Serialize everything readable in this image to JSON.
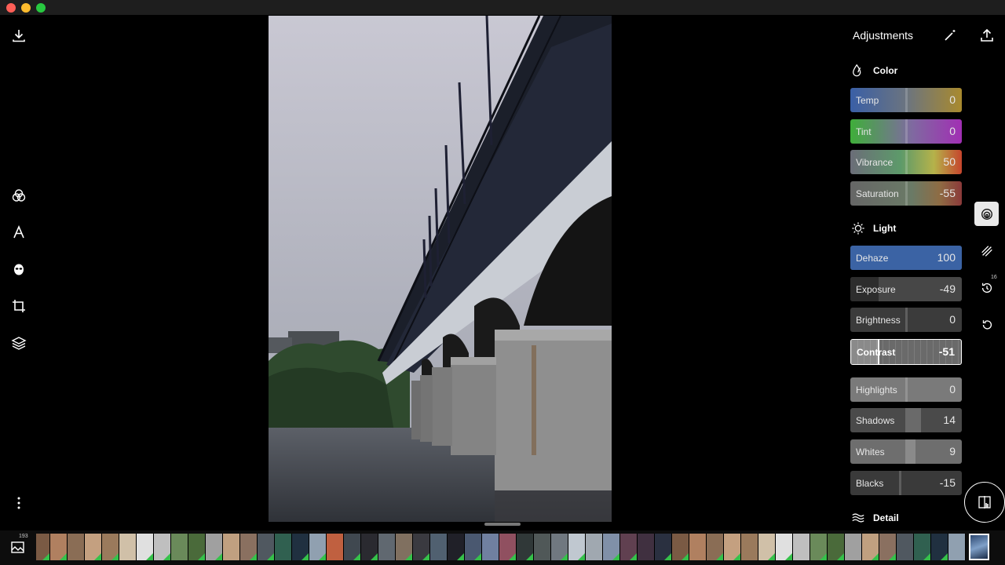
{
  "window": {
    "controls": [
      "close",
      "minimize",
      "maximize"
    ]
  },
  "left_toolbar": [
    {
      "name": "export-download-icon",
      "label": "Export"
    },
    {
      "name": "adjustments-icon",
      "label": "Adjustments"
    },
    {
      "name": "text-icon",
      "label": "Text"
    },
    {
      "name": "retouch-icon",
      "label": "Retouch"
    },
    {
      "name": "crop-icon",
      "label": "Crop"
    },
    {
      "name": "layers-icon",
      "label": "Layers"
    },
    {
      "name": "more-icon",
      "label": "More"
    }
  ],
  "panel": {
    "title": "Adjustments",
    "sections": {
      "color": "Color",
      "light": "Light",
      "detail": "Detail"
    },
    "sliders": {
      "temp": {
        "label": "Temp",
        "value": "0"
      },
      "tint": {
        "label": "Tint",
        "value": "0"
      },
      "vibrance": {
        "label": "Vibrance",
        "value": "50"
      },
      "saturation": {
        "label": "Saturation",
        "value": "-55"
      },
      "dehaze": {
        "label": "Dehaze",
        "value": "100"
      },
      "exposure": {
        "label": "Exposure",
        "value": "-49"
      },
      "brightness": {
        "label": "Brightness",
        "value": "0"
      },
      "contrast": {
        "label": "Contrast",
        "value": "-51"
      },
      "highlights": {
        "label": "Highlights",
        "value": "0"
      },
      "shadows": {
        "label": "Shadows",
        "value": "14"
      },
      "whites": {
        "label": "Whites",
        "value": "9"
      },
      "blacks": {
        "label": "Blacks",
        "value": "-15"
      }
    }
  },
  "right_tools": {
    "history_count": "16"
  },
  "filmstrip": {
    "photo_count": "193"
  },
  "colors": {
    "accent_blue": "#3b63a4",
    "edited_flag": "#35c14a"
  }
}
